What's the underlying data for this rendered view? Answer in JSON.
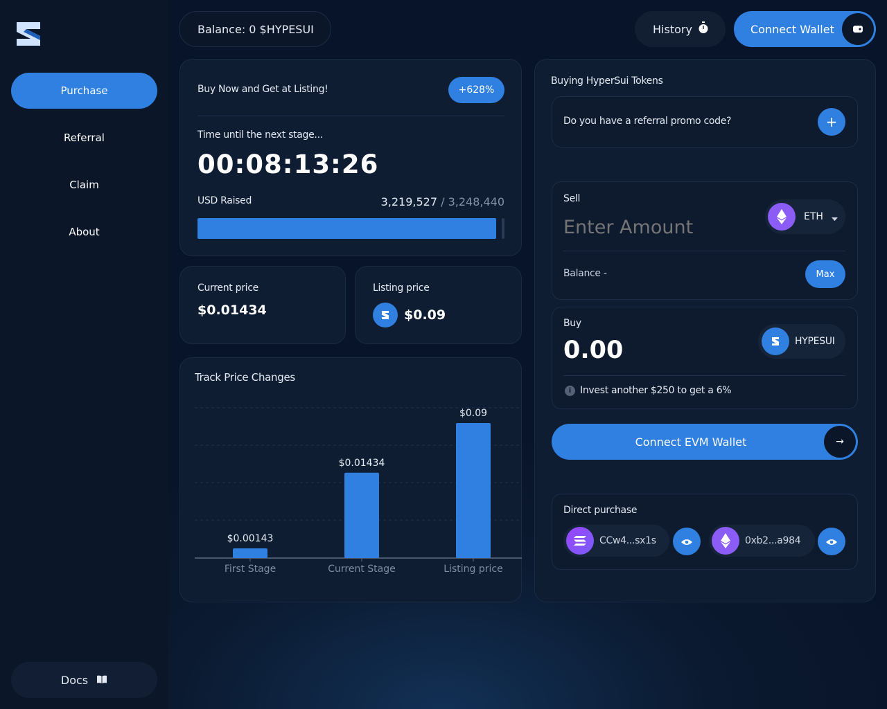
{
  "sidebar": {
    "logo_icon": "hypersui-logo",
    "items": [
      {
        "label": "Purchase",
        "active": true
      },
      {
        "label": "Referral",
        "active": false
      },
      {
        "label": "Claim",
        "active": false
      },
      {
        "label": "About",
        "active": false
      }
    ],
    "docs_label": "Docs",
    "docs_icon": "book-icon"
  },
  "header": {
    "balance_label": "Balance: 0 $HYPESUI",
    "history_label": "History",
    "history_icon": "stopwatch-icon",
    "connect_label": "Connect Wallet",
    "connect_icon": "wallet-icon"
  },
  "stage": {
    "promo_text": "Buy Now and Get at Listing!",
    "promo_badge": "+628%",
    "timer_label": "Time until the next stage...",
    "timer_value": "00:08:13:26",
    "raised_label": "USD Raised",
    "raised_value": "3,219,527",
    "raised_separator": " / ",
    "raised_target": "3,248,440",
    "raised_progress_fraction": 0.991
  },
  "prices": {
    "current_label": "Current price",
    "current_value": "$0.01434",
    "listing_label": "Listing price",
    "listing_value": "$0.09"
  },
  "chart_title": "Track Price Changes",
  "chart_data": {
    "type": "bar",
    "title": "Track Price Changes",
    "categories": [
      "First Stage",
      "Current Stage",
      "Listing price"
    ],
    "values": [
      0.00143,
      0.01434,
      0.09
    ],
    "value_labels": [
      "$0.00143",
      "$0.01434",
      "$0.09"
    ],
    "bar_color": "#2f80e0",
    "grid": true
  },
  "buy_panel": {
    "title": "Buying HyperSui Tokens",
    "referral_question": "Do you have a referral promo code?",
    "referral_button": "+",
    "sell_label": "Sell",
    "sell_placeholder": "Enter Amount",
    "sell_token": "ETH",
    "sell_balance_label": "Balance -",
    "max_label": "Max",
    "buy_label": "Buy",
    "buy_value": "0.00",
    "buy_token": "HYPESUI",
    "invest_hint": "Invest another $250 to get a",
    "invest_bonus": "6%",
    "connect_evm_label": "Connect EVM Wallet",
    "connect_evm_arrow": "→",
    "direct_title": "Direct purchase",
    "direct_wallets": [
      {
        "label": "CCw4...sx1s",
        "icon": "solana-icon"
      },
      {
        "label": "0xb2...a984",
        "icon": "ethereum-icon"
      }
    ]
  },
  "colors": {
    "accent": "#2f80e0",
    "background": "#0a1628",
    "card": "#0f1d32",
    "eth_purple": "#8b5cf6",
    "sui_blue": "#2f80e0"
  }
}
